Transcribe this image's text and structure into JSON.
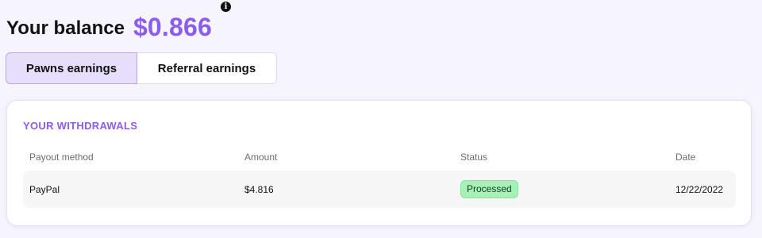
{
  "balance": {
    "label": "Your balance",
    "value": "$0.866",
    "info_icon": "info-icon"
  },
  "tabs": [
    {
      "label": "Pawns earnings",
      "active": true
    },
    {
      "label": "Referral earnings",
      "active": false
    }
  ],
  "withdrawals": {
    "title": "YOUR WITHDRAWALS",
    "columns": [
      "Payout method",
      "Amount",
      "Status",
      "Date"
    ],
    "rows": [
      {
        "method": "PayPal",
        "amount": "$4.816",
        "status": "Processed",
        "date": "12/22/2022"
      }
    ]
  },
  "colors": {
    "accent": "#8a5cf0",
    "active_tab_bg": "#e7defb",
    "status_processed": "#a6f1b8",
    "page_bg": "#f6f4fd"
  }
}
